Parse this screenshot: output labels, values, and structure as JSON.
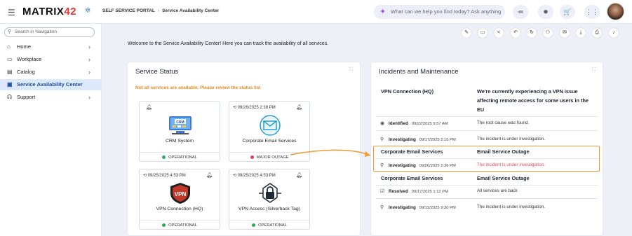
{
  "header": {
    "logo": "MATRIX42",
    "breadcrumb": [
      "SELF SERVICE PORTAL",
      "Service Availability Center"
    ],
    "ask_placeholder": "What can we help you find today? Ask anything"
  },
  "sidebar": {
    "search_placeholder": "Search in Navigation",
    "items": [
      {
        "label": "Home"
      },
      {
        "label": "Workplace"
      },
      {
        "label": "Catalog"
      },
      {
        "label": "Service Availability Center"
      },
      {
        "label": "Support"
      }
    ]
  },
  "welcome": "Welcome to the Service Availability Center! Here you can track the availability of all services.",
  "service_status": {
    "title": "Service Status",
    "warning": "Not all services are available. Please review the status list",
    "services": [
      {
        "name": "CRM System",
        "date": "",
        "status": "OPERATIONAL"
      },
      {
        "name": "Corporate Email Services",
        "date": "09/26/2025 2:38 PM",
        "status": "MAJOR OUTAGE"
      },
      {
        "name": "VPN Connection (HQ)",
        "date": "09/25/2025 4:53 PM",
        "status": "OPERATIONAL"
      },
      {
        "name": "VPN Access (Silverback Tag)",
        "date": "09/25/2025 4:53 PM",
        "status": "OPERATIONAL"
      }
    ],
    "icon_texts": {
      "crm": "CRM",
      "vpn": "VPN"
    }
  },
  "incidents": {
    "title": "Incidents and Maintenance",
    "groups": [
      {
        "service": "VPN Connection (HQ)",
        "summary": "We're currently experiencing a VPN issue affecting remote access for some users in the EU",
        "entries": [
          {
            "state": "Identified",
            "date": "09/22/2025 9:57 AM",
            "message": "The root cause was found."
          },
          {
            "state": "Investigating",
            "date": "09/17/2025 2:15 PM",
            "message": "The incident is under investigation."
          }
        ]
      },
      {
        "service": "Corporate Email Services",
        "summary": "Email Service Outage",
        "entries": [
          {
            "state": "Investigating",
            "date": "09/26/2025 2:36 PM",
            "message": "The incident is under investigation."
          }
        ]
      },
      {
        "service": "Corporate Email Services",
        "summary": "Email Service Outage",
        "entries": [
          {
            "state": "Resolved",
            "date": "09/17/2025 1:12 PM",
            "message": "All services are back"
          },
          {
            "state": "Investigating",
            "date": "09/12/2025 9:30 PM",
            "message": "The incident is under investigation."
          }
        ]
      }
    ]
  },
  "colors": {
    "operational": "#2eaa5a",
    "outage": "#e0455a",
    "highlight": "#f29a35",
    "active_nav": "#dce8fb"
  }
}
